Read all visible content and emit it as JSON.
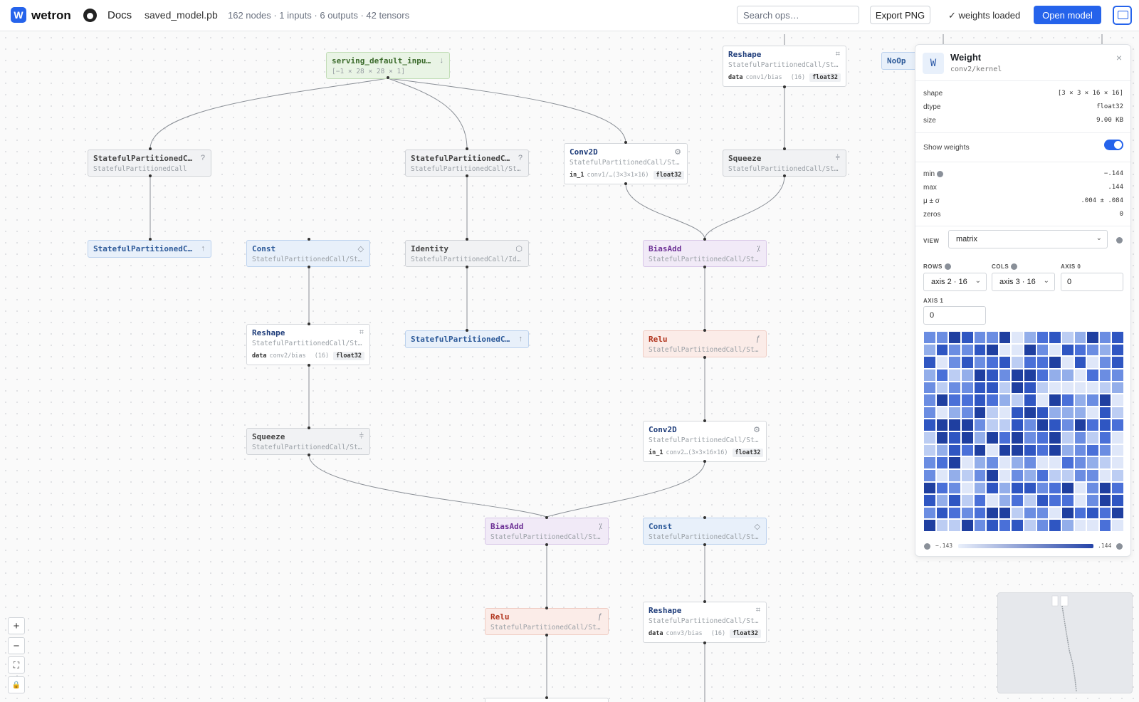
{
  "topbar": {
    "app_name": "wetron",
    "logo_letter": "W",
    "docs_label": "Docs",
    "file_name": "saved_model.pb",
    "stats": "162 nodes · 1 inputs · 6 outputs · 42 tensors",
    "search_placeholder": "Search ops…",
    "export_label": "Export PNG",
    "weights_status": "✓ weights loaded",
    "open_label": "Open model"
  },
  "colors": {
    "accent": "#2563eb",
    "low": "#eaf0fb",
    "high": "#2443a8"
  },
  "graph": {
    "nodes": [
      {
        "op": "serving_default_inputs",
        "sub": "[−1 × 28 × 28 × 1]",
        "icon": "arrow-down-icon",
        "glyph": "↓"
      },
      {
        "op": "StatefulPartitionedCa…",
        "sub": "StatefulPartitionedCall",
        "icon": "question-icon",
        "glyph": "?"
      },
      {
        "op": "StatefulPartitionedCa…",
        "sub": "StatefulPartitionedCall/State…",
        "icon": "question-icon",
        "glyph": "?"
      },
      {
        "op": "Conv2D",
        "sub": "StatefulPartitionedCall/State…",
        "icon": "gear-icon",
        "glyph": "⚙",
        "det": {
          "k": "in_1",
          "n": "conv1/…",
          "s": "(3×3×1×16)",
          "dt": "float32"
        }
      },
      {
        "op": "Reshape",
        "sub": "StatefulPartitionedCall/State…",
        "icon": "reshape-icon",
        "glyph": "⌗",
        "det": {
          "k": "data",
          "n": "conv1/bias",
          "s": "(16)",
          "dt": "float32"
        }
      },
      {
        "op": "Squeeze",
        "sub": "StatefulPartitionedCall/State…",
        "icon": "squeeze-icon",
        "glyph": "⫩"
      },
      {
        "op": "StatefulPartitionedCa…",
        "sub": "",
        "icon": "arrow-up-icon",
        "glyph": "↑"
      },
      {
        "op": "Const",
        "sub": "StatefulPartitionedCall/State…",
        "icon": "diamond-icon",
        "glyph": "◇"
      },
      {
        "op": "Identity",
        "sub": "StatefulPartitionedCall/Ident…",
        "icon": "cube-icon",
        "glyph": "⬡"
      },
      {
        "op": "BiasAdd",
        "sub": "StatefulPartitionedCall/State…",
        "icon": "percent-icon",
        "glyph": "⁒"
      },
      {
        "op": "Reshape",
        "sub": "StatefulPartitionedCall/State…",
        "icon": "reshape-icon",
        "glyph": "⌗",
        "det": {
          "k": "data",
          "n": "conv2/bias",
          "s": "(16)",
          "dt": "float32"
        }
      },
      {
        "op": "StatefulPartitionedCa…",
        "sub": "",
        "icon": "arrow-up-icon",
        "glyph": "↑"
      },
      {
        "op": "Relu",
        "sub": "StatefulPartitionedCall/State…",
        "icon": "function-icon",
        "glyph": "ƒ"
      },
      {
        "op": "Squeeze",
        "sub": "StatefulPartitionedCall/State…",
        "icon": "squeeze-icon",
        "glyph": "⫩"
      },
      {
        "op": "Conv2D",
        "sub": "StatefulPartitionedCall/State…",
        "icon": "gear-icon",
        "glyph": "⚙",
        "det": {
          "k": "in_1",
          "n": "conv2…",
          "s": "(3×3×16×16)",
          "dt": "float32"
        }
      },
      {
        "op": "BiasAdd",
        "sub": "StatefulPartitionedCall/State…",
        "icon": "percent-icon",
        "glyph": "⁒"
      },
      {
        "op": "Const",
        "sub": "StatefulPartitionedCall/State…",
        "icon": "diamond-icon",
        "glyph": "◇"
      },
      {
        "op": "Relu",
        "sub": "StatefulPartitionedCall/State…",
        "icon": "function-icon",
        "glyph": "ƒ"
      },
      {
        "op": "Reshape",
        "sub": "StatefulPartitionedCall/State…",
        "icon": "reshape-icon",
        "glyph": "⌗",
        "det": {
          "k": "data",
          "n": "conv3/bias",
          "s": "(16)",
          "dt": "float32"
        }
      },
      {
        "op": "NoOp",
        "sub": ""
      }
    ]
  },
  "zoom": {
    "in": "+",
    "out": "−",
    "fit": "⛶",
    "lock": "🔒"
  },
  "panel": {
    "icon_letter": "W",
    "title": "Weight",
    "subtitle": "conv2/kernel",
    "close": "×",
    "shape_label": "shape",
    "shape_value": "[3 × 3 × 16 × 16]",
    "dtype_label": "dtype",
    "dtype_value": "float32",
    "size_label": "size",
    "size_value": "9.00 KB",
    "show_weights_label": "Show weights",
    "show_weights": true,
    "min_label": "min",
    "min_value": "−.144",
    "max_label": "max",
    "max_value": ".144",
    "mean_label": "μ ± σ",
    "mean_value": ".004 ± .084",
    "zeros_label": "zeros",
    "zeros_value": "0",
    "view_label": "VIEW",
    "view_value": "matrix",
    "rows_label": "ROWS",
    "rows_value": "axis 2 · 16",
    "cols_label": "COLS",
    "cols_value": "axis 3 · 16",
    "axis0_label": "AXIS 0",
    "axis0_value": "0",
    "axis1_label": "AXIS 1",
    "axis1_value": "0",
    "scale_min": "−.143",
    "scale_max": ".144"
  }
}
